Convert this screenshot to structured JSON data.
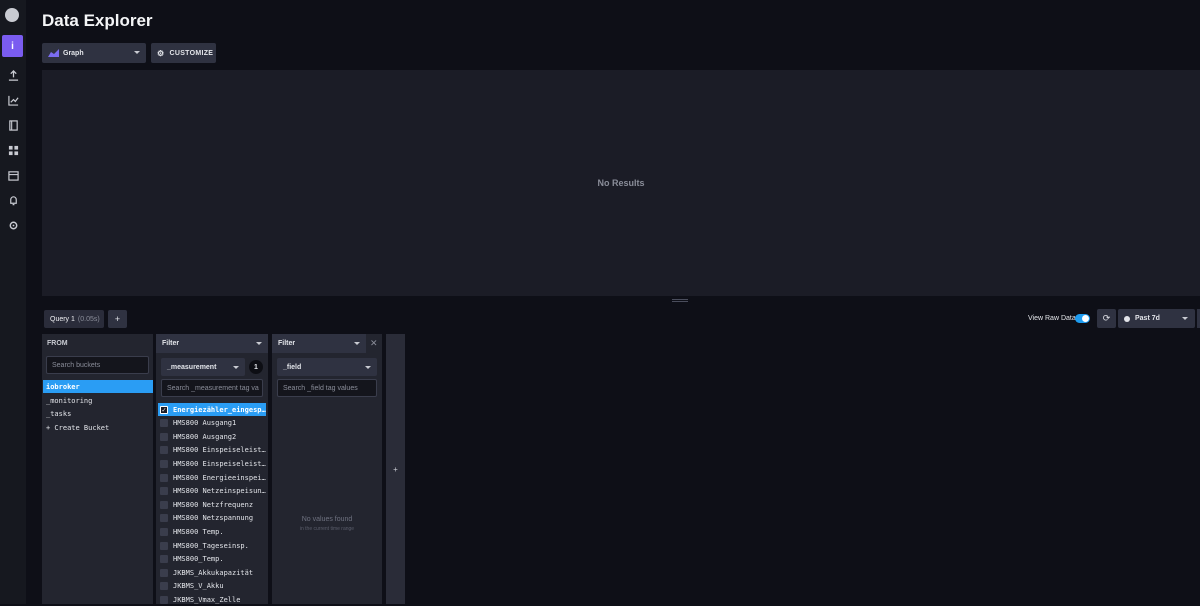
{
  "title": "Data Explorer",
  "toolbar": {
    "view_type": "Graph",
    "customize_label": "CUSTOMIZE"
  },
  "results": {
    "message": "No Results"
  },
  "query": {
    "tab_label": "Query 1",
    "tab_time": "(0.05s)",
    "add_label": "+"
  },
  "controls": {
    "raw_data_label": "View Raw Data",
    "time_range": "Past 7d"
  },
  "from": {
    "header": "FROM",
    "search_placeholder": "Search buckets",
    "buckets": [
      "iobroker",
      "_monitoring",
      "_tasks",
      "+ Create Bucket"
    ],
    "selected": "iobroker"
  },
  "filter1": {
    "header": "Filter",
    "key": "_measurement",
    "count": "1",
    "search_placeholder": "Search _measurement tag va",
    "values": [
      "Energiezähler_eingesp…",
      "HMS800 Ausgang1",
      "HMS800 Ausgang2",
      "HMS800 Einspeiseleist…",
      "HMS800 Einspeiseleist…",
      "HMS800 Energieeinspei…",
      "HMS800 Netzeinspeisun…",
      "HMS800 Netzfrequenz",
      "HMS800 Netzspannung",
      "HMS800 Temp.",
      "HMS800_Tageseinsp.",
      "HMS800_Temp.",
      "JKBMS_Akkukapazität",
      "JKBMS_V_Akku",
      "JKBMS_Vmax_Zelle"
    ]
  },
  "filter2": {
    "header": "Filter",
    "key": "_field",
    "search_placeholder": "Search _field tag values",
    "empty_title": "No values found",
    "empty_sub": "in the current time range"
  },
  "add_filter_label": "+",
  "colors": {
    "accent": "#7a5cf0",
    "selection": "#2a9df4",
    "toggle": "#1e9cf0"
  }
}
